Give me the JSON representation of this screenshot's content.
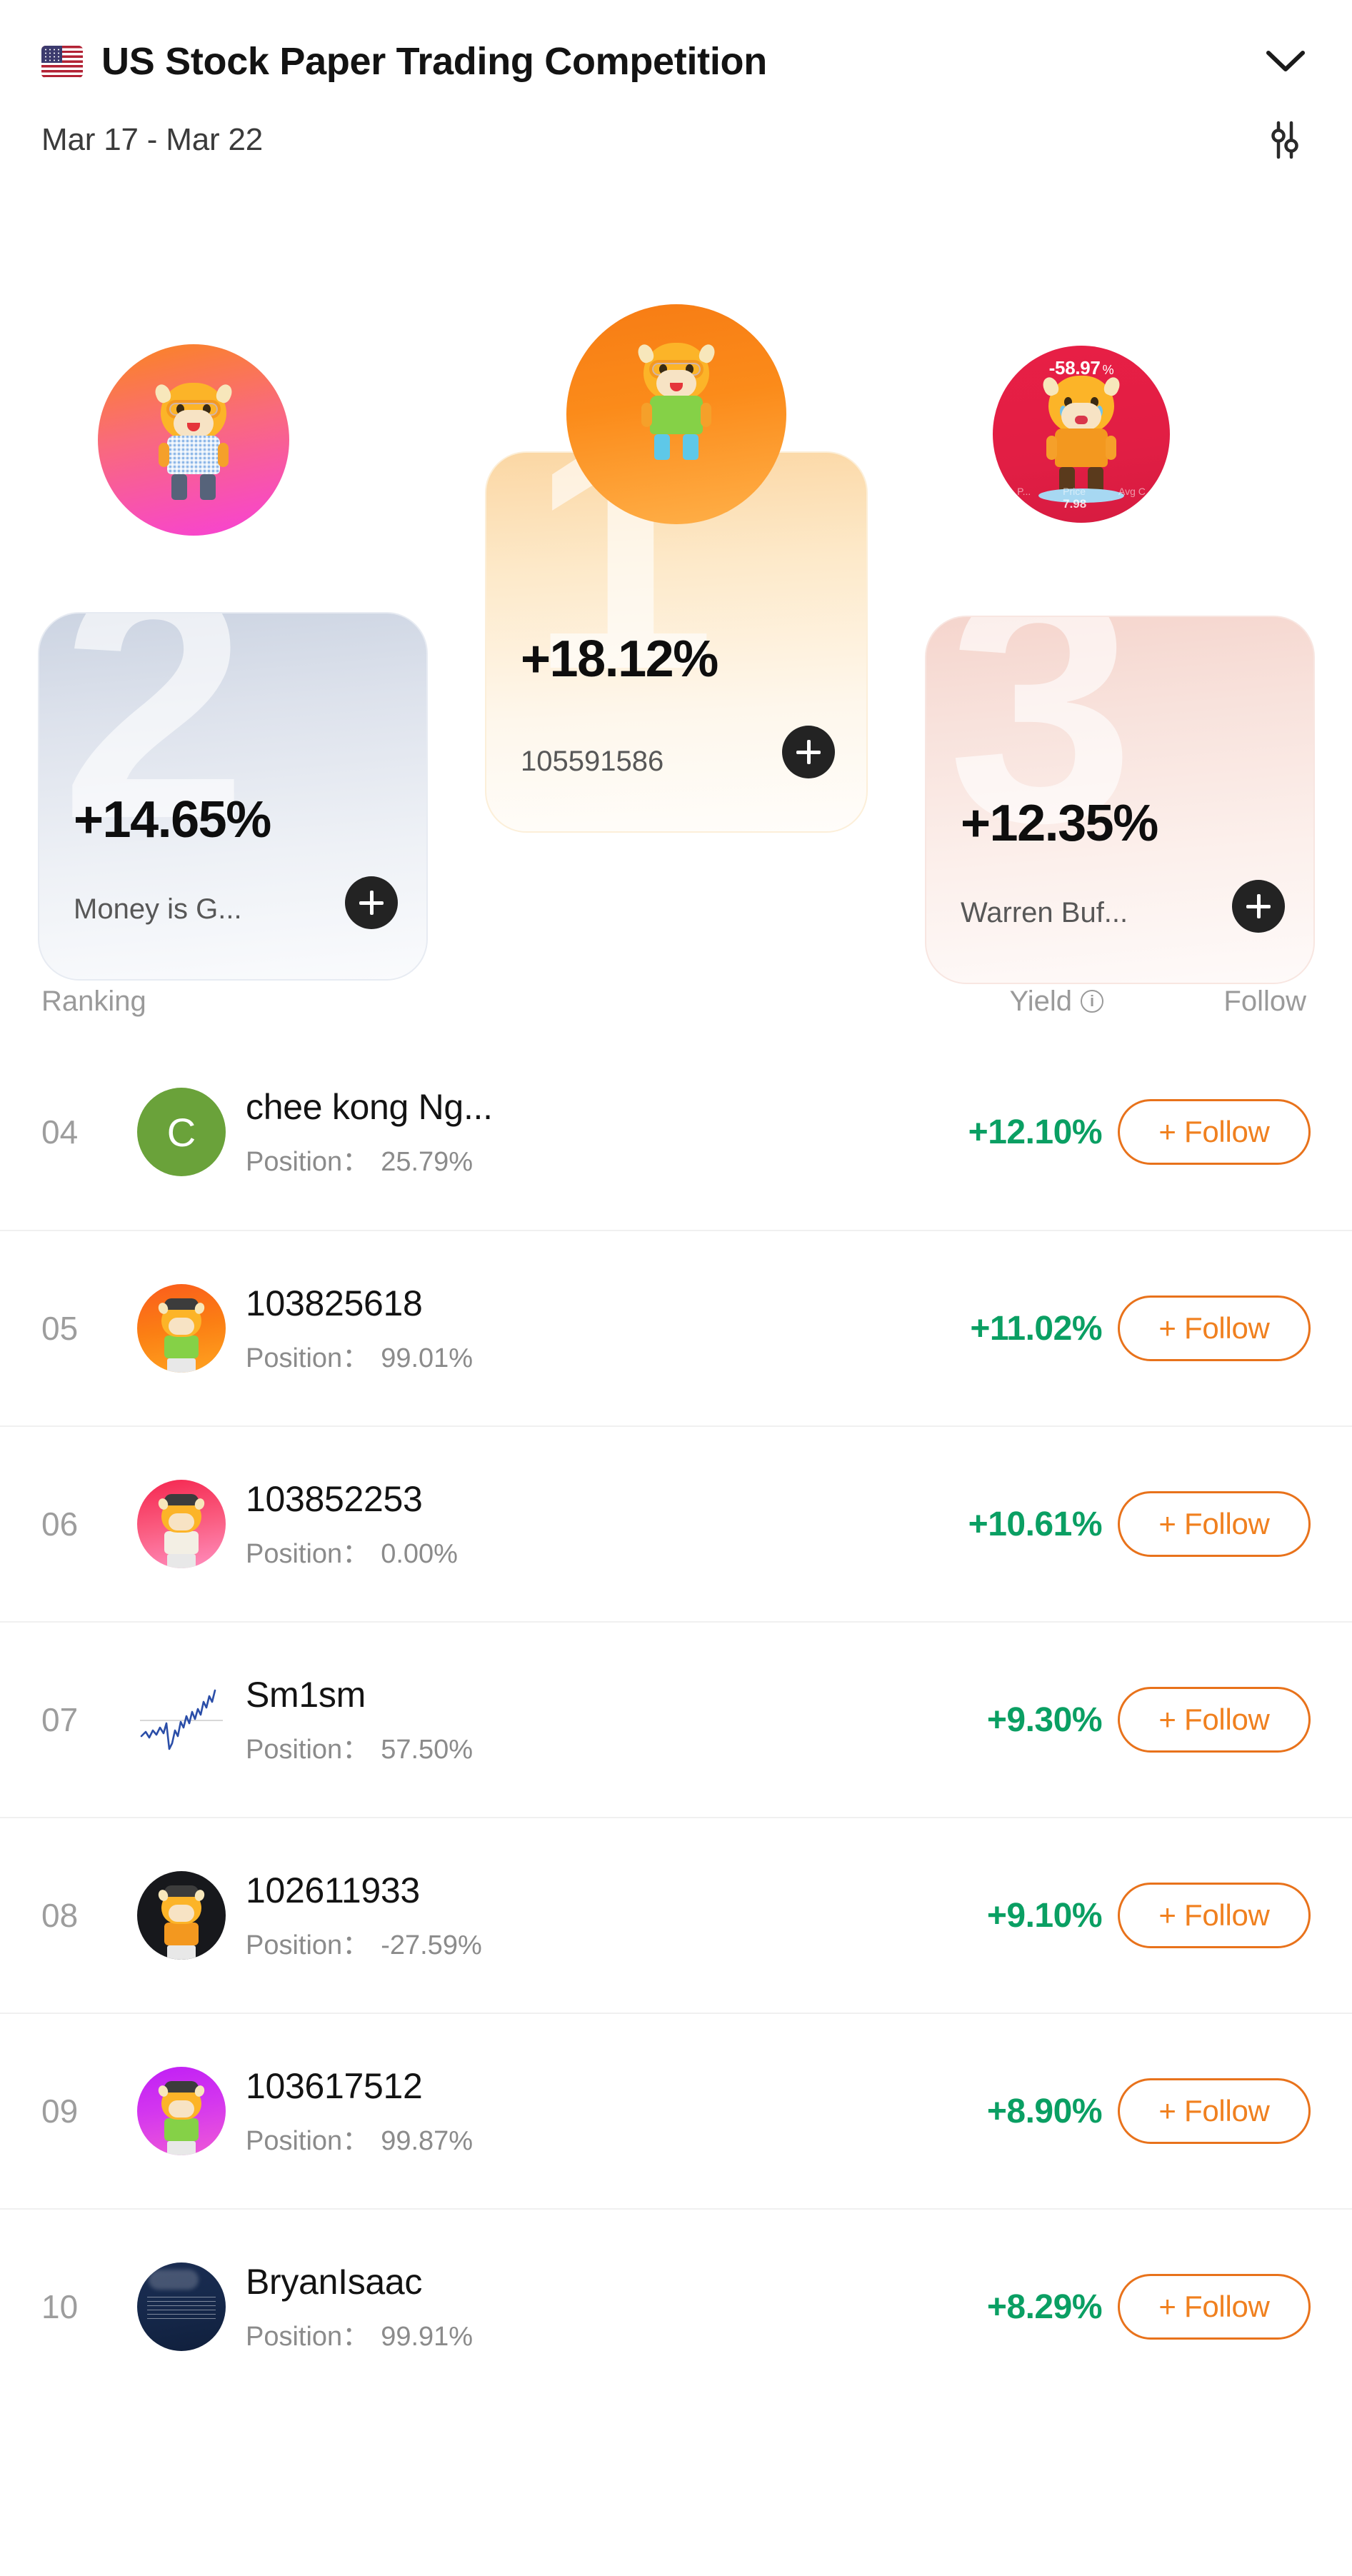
{
  "header": {
    "flag_icon": "us-flag-icon",
    "title": "US Stock Paper Trading Competition",
    "expand_icon": "chevron-down-icon",
    "date_range": "Mar 17 - Mar 22",
    "filter_icon": "sliders-filter-icon"
  },
  "podium": {
    "first": {
      "rank": "1",
      "yield": "+18.12%",
      "name": "105591586",
      "add_label": "+",
      "avatar_badge": ""
    },
    "second": {
      "rank": "2",
      "yield": "+14.65%",
      "name": "Money is G...",
      "add_label": "+",
      "avatar_badge": ""
    },
    "third": {
      "rank": "3",
      "yield": "+12.35%",
      "name": "Warren Buf...",
      "add_label": "+",
      "avatar_badge": "-58.97",
      "avatar_badge_unit": "%",
      "avatar_mini_price_label": "Price",
      "avatar_mini_price_value": "7.98",
      "avatar_mini_avgcost_label": "Avg C...",
      "avatar_mini_left_label": "...P..."
    }
  },
  "list_header": {
    "ranking": "Ranking",
    "yield": "Yield",
    "yield_info_icon": "info-icon",
    "follow": "Follow"
  },
  "rows": [
    {
      "rank": "04",
      "name": "chee kong Ng...",
      "position_label": "Position：",
      "position_value": "25.79%",
      "yield": "+12.10%",
      "follow_label": "+ Follow",
      "avatar_type": "letter",
      "avatar_letter": "C",
      "avatar_color": "#6aa23a"
    },
    {
      "rank": "05",
      "name": "103825618",
      "position_label": "Position：",
      "position_value": "99.01%",
      "yield": "+11.02%",
      "follow_label": "+ Follow",
      "avatar_type": "bull-green",
      "avatar_color": "#fb7f14"
    },
    {
      "rank": "06",
      "name": "103852253",
      "position_label": "Position：",
      "position_value": "0.00%",
      "yield": "+10.61%",
      "follow_label": "+ Follow",
      "avatar_type": "bull-white",
      "avatar_color": "#fa5c80"
    },
    {
      "rank": "07",
      "name": "Sm1sm",
      "position_label": "Position：",
      "position_value": "57.50%",
      "yield": "+9.30%",
      "follow_label": "+ Follow",
      "avatar_type": "sparkline",
      "avatar_color": "#2b4ea8"
    },
    {
      "rank": "08",
      "name": "102611933",
      "position_label": "Position：",
      "position_value": "-27.59%",
      "yield": "+9.10%",
      "follow_label": "+ Follow",
      "avatar_type": "bull-dark",
      "avatar_color": "#17181c"
    },
    {
      "rank": "09",
      "name": "103617512",
      "position_label": "Position：",
      "position_value": "99.87%",
      "yield": "+8.90%",
      "follow_label": "+ Follow",
      "avatar_type": "bull-green",
      "avatar_color": "#d336ef"
    },
    {
      "rank": "10",
      "name": "BryanIsaac",
      "position_label": "Position：",
      "position_value": "99.91%",
      "yield": "+8.29%",
      "follow_label": "+ Follow",
      "avatar_type": "photo-navy",
      "avatar_color": "#16294c"
    }
  ],
  "colors": {
    "yield_green": "#0a9f63",
    "follow_orange": "#f0801f",
    "follow_border": "#e8721b",
    "text_primary": "#131313",
    "text_secondary": "#8b8b8b",
    "rank_gray": "#9d9d9d"
  }
}
